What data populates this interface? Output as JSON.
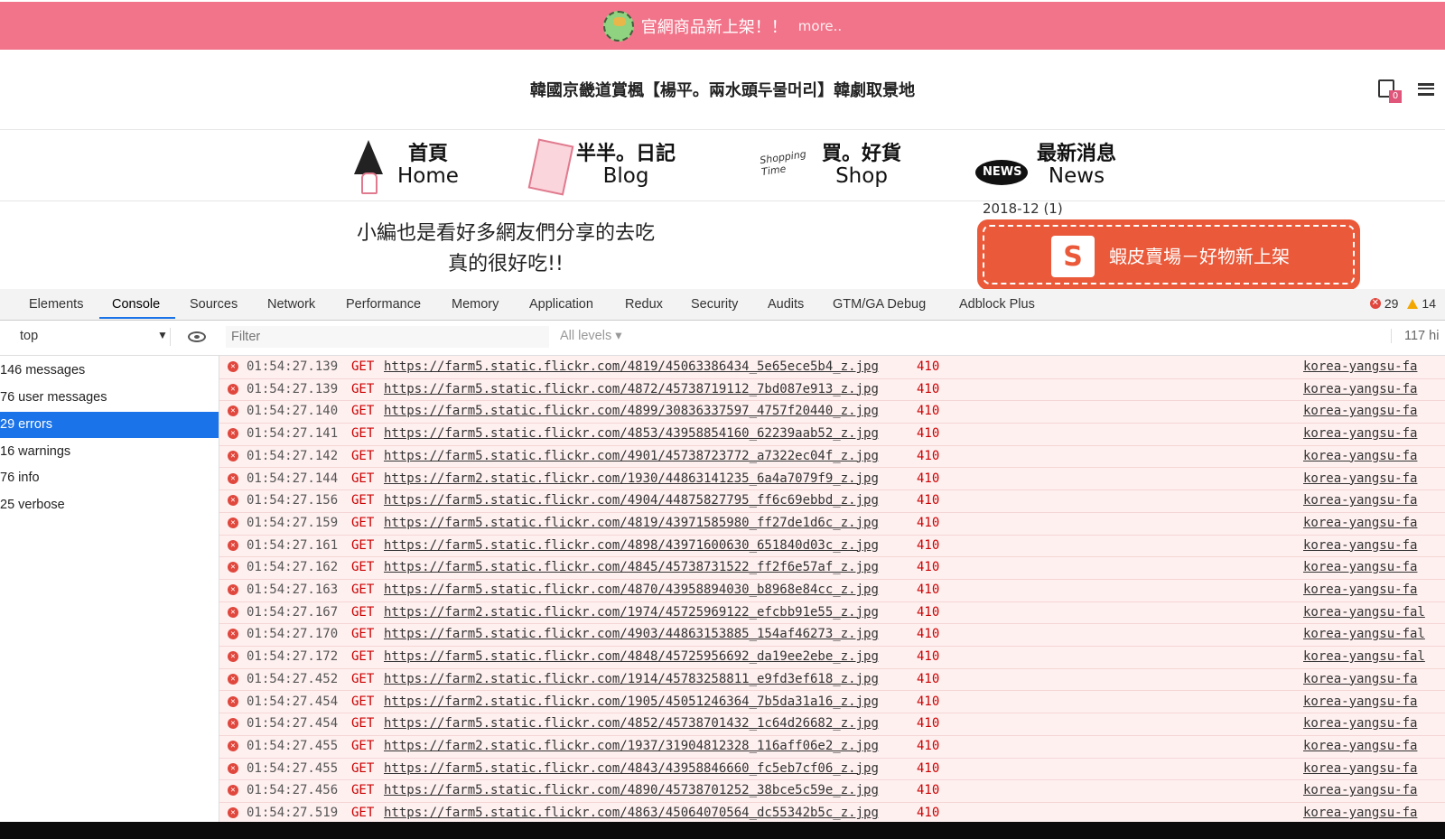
{
  "promo": {
    "text": "官網商品新上架！！",
    "more": "more.."
  },
  "site": {
    "title": "韓國京畿道賞楓【楊平。兩水頭두물머리】韓劇取景地",
    "cart_count": "0"
  },
  "nav": [
    {
      "zh": "首頁",
      "en": "Home"
    },
    {
      "zh": "半半。日記",
      "en": "Blog"
    },
    {
      "zh": "買。好貨",
      "en": "Shop"
    },
    {
      "zh": "最新消息",
      "en": "News"
    }
  ],
  "article": {
    "line1": "小編也是看好多網友們分享的去吃",
    "line2": "真的很好吃!!"
  },
  "archive": {
    "label": "2018-12 (1)"
  },
  "shopee": {
    "text": "蝦皮賣場－好物新上架",
    "bag_letter": "S"
  },
  "devtools": {
    "tabs": [
      "Elements",
      "Console",
      "Sources",
      "Network",
      "Performance",
      "Memory",
      "Application",
      "Redux",
      "Security",
      "Audits",
      "GTM/GA Debug",
      "Adblock Plus"
    ],
    "error_count": "29",
    "warning_count": "14",
    "context": "top",
    "filter_placeholder": "Filter",
    "levels": "All levels ▾",
    "hidden": "117 hi",
    "sidebar": [
      "146 messages",
      "76 user messages",
      "29 errors",
      "16 warnings",
      "76 info",
      "25 verbose"
    ],
    "rows": [
      {
        "ts": "01:54:27.139",
        "method": "GET",
        "url": "https://farm5.static.flickr.com/4819/45063386434_5e65ece5b4_z.jpg",
        "status": "410",
        "src": "korea-yangsu-fa"
      },
      {
        "ts": "01:54:27.139",
        "method": "GET",
        "url": "https://farm5.static.flickr.com/4872/45738719112_7bd087e913_z.jpg",
        "status": "410",
        "src": "korea-yangsu-fa"
      },
      {
        "ts": "01:54:27.140",
        "method": "GET",
        "url": "https://farm5.static.flickr.com/4899/30836337597_4757f20440_z.jpg",
        "status": "410",
        "src": "korea-yangsu-fa"
      },
      {
        "ts": "01:54:27.141",
        "method": "GET",
        "url": "https://farm5.static.flickr.com/4853/43958854160_62239aab52_z.jpg",
        "status": "410",
        "src": "korea-yangsu-fa"
      },
      {
        "ts": "01:54:27.142",
        "method": "GET",
        "url": "https://farm5.static.flickr.com/4901/45738723772_a7322ec04f_z.jpg",
        "status": "410",
        "src": "korea-yangsu-fa"
      },
      {
        "ts": "01:54:27.144",
        "method": "GET",
        "url": "https://farm2.static.flickr.com/1930/44863141235_6a4a7079f9_z.jpg",
        "status": "410",
        "src": "korea-yangsu-fa"
      },
      {
        "ts": "01:54:27.156",
        "method": "GET",
        "url": "https://farm5.static.flickr.com/4904/44875827795_ff6c69ebbd_z.jpg",
        "status": "410",
        "src": "korea-yangsu-fa"
      },
      {
        "ts": "01:54:27.159",
        "method": "GET",
        "url": "https://farm5.static.flickr.com/4819/43971585980_ff27de1d6c_z.jpg",
        "status": "410",
        "src": "korea-yangsu-fa"
      },
      {
        "ts": "01:54:27.161",
        "method": "GET",
        "url": "https://farm5.static.flickr.com/4898/43971600630_651840d03c_z.jpg",
        "status": "410",
        "src": "korea-yangsu-fa"
      },
      {
        "ts": "01:54:27.162",
        "method": "GET",
        "url": "https://farm5.static.flickr.com/4845/45738731522_ff2f6e57af_z.jpg",
        "status": "410",
        "src": "korea-yangsu-fa"
      },
      {
        "ts": "01:54:27.163",
        "method": "GET",
        "url": "https://farm5.static.flickr.com/4870/43958894030_b8968e84cc_z.jpg",
        "status": "410",
        "src": "korea-yangsu-fa"
      },
      {
        "ts": "01:54:27.167",
        "method": "GET",
        "url": "https://farm2.static.flickr.com/1974/45725969122_efcbb91e55_z.jpg",
        "status": "410",
        "src": "korea-yangsu-fal"
      },
      {
        "ts": "01:54:27.170",
        "method": "GET",
        "url": "https://farm5.static.flickr.com/4903/44863153885_154af46273_z.jpg",
        "status": "410",
        "src": "korea-yangsu-fal"
      },
      {
        "ts": "01:54:27.172",
        "method": "GET",
        "url": "https://farm5.static.flickr.com/4848/45725956692_da19ee2ebe_z.jpg",
        "status": "410",
        "src": "korea-yangsu-fal"
      },
      {
        "ts": "01:54:27.452",
        "method": "GET",
        "url": "https://farm2.static.flickr.com/1914/45783258811_e9fd3ef618_z.jpg",
        "status": "410",
        "src": "korea-yangsu-fa"
      },
      {
        "ts": "01:54:27.454",
        "method": "GET",
        "url": "https://farm2.static.flickr.com/1905/45051246364_7b5da31a16_z.jpg",
        "status": "410",
        "src": "korea-yangsu-fa"
      },
      {
        "ts": "01:54:27.454",
        "method": "GET",
        "url": "https://farm5.static.flickr.com/4852/45738701432_1c64d26682_z.jpg",
        "status": "410",
        "src": "korea-yangsu-fa"
      },
      {
        "ts": "01:54:27.455",
        "method": "GET",
        "url": "https://farm2.static.flickr.com/1937/31904812328_116aff06e2_z.jpg",
        "status": "410",
        "src": "korea-yangsu-fa"
      },
      {
        "ts": "01:54:27.455",
        "method": "GET",
        "url": "https://farm5.static.flickr.com/4843/43958846660_fc5eb7cf06_z.jpg",
        "status": "410",
        "src": "korea-yangsu-fa"
      },
      {
        "ts": "01:54:27.456",
        "method": "GET",
        "url": "https://farm5.static.flickr.com/4890/45738701252_38bce5c59e_z.jpg",
        "status": "410",
        "src": "korea-yangsu-fa"
      },
      {
        "ts": "01:54:27.519",
        "method": "GET",
        "url": "https://farm5.static.flickr.com/4863/45064070564_dc55342b5c_z.jpg",
        "status": "410",
        "src": "korea-yangsu-fa"
      }
    ]
  }
}
